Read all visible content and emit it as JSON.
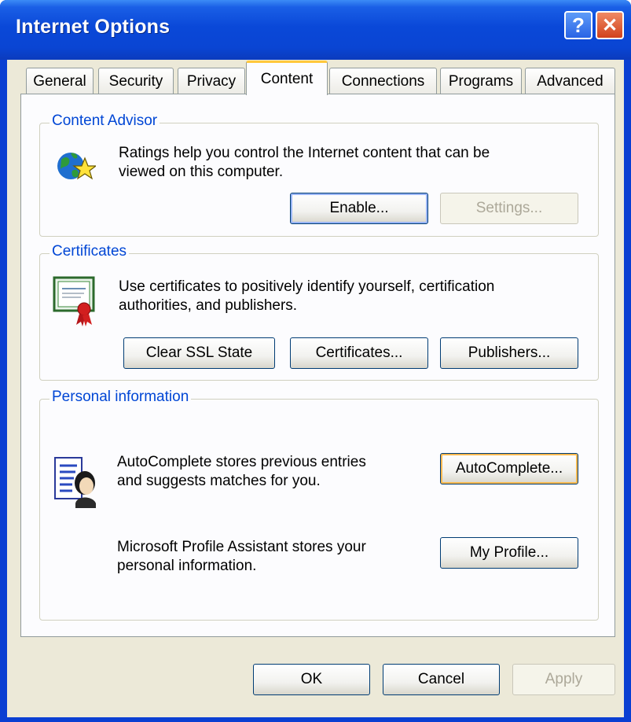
{
  "window": {
    "title": "Internet Options",
    "help_glyph": "?",
    "close_glyph": "✕"
  },
  "tabs": [
    {
      "label": "General"
    },
    {
      "label": "Security"
    },
    {
      "label": "Privacy"
    },
    {
      "label": "Content",
      "active": true
    },
    {
      "label": "Connections"
    },
    {
      "label": "Programs"
    },
    {
      "label": "Advanced"
    }
  ],
  "content_advisor": {
    "title": "Content Advisor",
    "description_line1": "Ratings help you control the Internet content that can be",
    "description_line2": "viewed on this computer.",
    "enable_label": "Enable...",
    "settings_label": "Settings...",
    "icon": "globe-star-icon"
  },
  "certificates": {
    "title": "Certificates",
    "description_line1": "Use certificates to positively identify yourself, certification",
    "description_line2": "authorities, and publishers.",
    "clear_ssl_label": "Clear SSL State",
    "certificates_label": "Certificates...",
    "publishers_label": "Publishers...",
    "icon": "certificate-icon"
  },
  "personal_information": {
    "title": "Personal information",
    "autocomplete_line1": "AutoComplete stores previous entries",
    "autocomplete_line2": "and suggests matches for you.",
    "autocomplete_label": "AutoComplete...",
    "profile_line1": "Microsoft Profile Assistant stores your",
    "profile_line2": "personal information.",
    "my_profile_label": "My Profile...",
    "icon": "profile-document-icon"
  },
  "footer": {
    "ok_label": "OK",
    "cancel_label": "Cancel",
    "apply_label": "Apply"
  },
  "colors": {
    "titlebar": "#0a48d8",
    "group_label": "#0046d5",
    "dialog_bg": "#ece9d8",
    "focus_ring": "#f8b94f"
  }
}
